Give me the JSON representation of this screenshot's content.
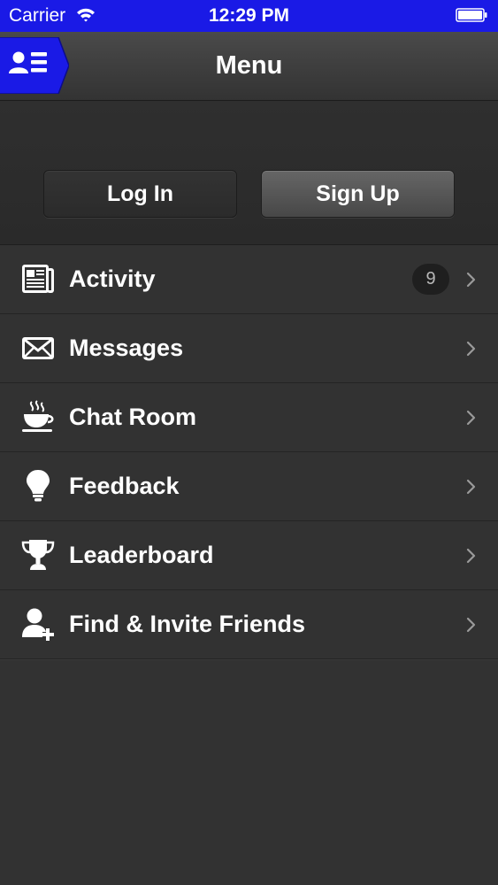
{
  "status_bar": {
    "carrier": "Carrier",
    "time": "12:29 PM",
    "wifi_icon": "wifi-icon",
    "battery_icon": "battery-icon",
    "background_color": "#1a1ae6"
  },
  "nav_bar": {
    "title": "Menu",
    "menu_button_icon": "contact-list-icon",
    "menu_button_color": "#1a1ae6"
  },
  "auth": {
    "login_label": "Log In",
    "signup_label": "Sign Up"
  },
  "menu": {
    "items": [
      {
        "label": "Activity",
        "icon": "newspaper-icon",
        "badge": "9"
      },
      {
        "label": "Messages",
        "icon": "envelope-icon"
      },
      {
        "label": "Chat Room",
        "icon": "coffee-cup-icon"
      },
      {
        "label": "Feedback",
        "icon": "lightbulb-icon"
      },
      {
        "label": "Leaderboard",
        "icon": "trophy-icon"
      },
      {
        "label": "Find & Invite Friends",
        "icon": "add-user-icon"
      }
    ],
    "chevron_icon": "chevron-right-icon"
  }
}
